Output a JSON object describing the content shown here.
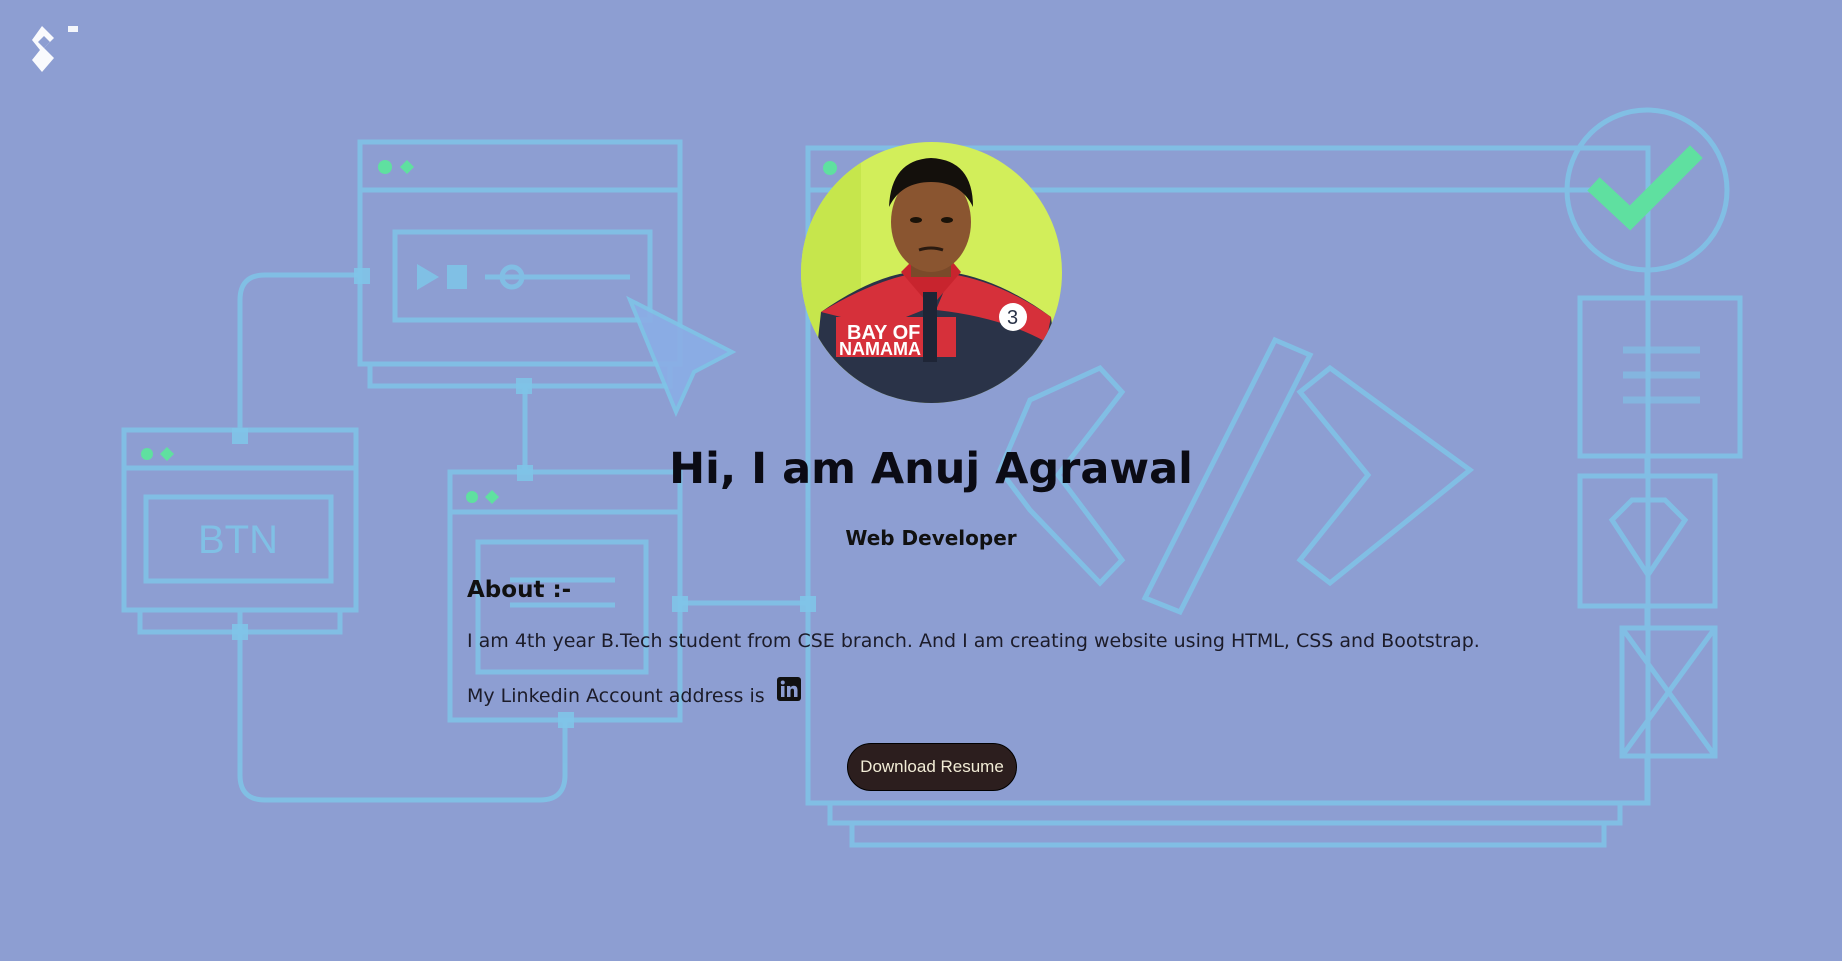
{
  "header": {
    "logo_icon": "toptal-logo-icon"
  },
  "profile": {
    "avatar_icon": "profile-photo",
    "greeting": "Hi, I am Anuj Agrawal",
    "role": "Web Developer"
  },
  "about": {
    "heading": "About :-",
    "text": "I am 4th year B.Tech student from CSE branch. And I am creating website using HTML, CSS and Bootstrap.",
    "linkedin_prefix": "My Linkedin Account address is",
    "linkedin_icon": "linkedin-icon"
  },
  "actions": {
    "download_label": "Download Resume"
  },
  "background": {
    "illustration_text": "BTN",
    "colors": {
      "page": "#8d9ed2",
      "line": "#7fc4e8",
      "accent_green": "#5fe0a0",
      "button_bg": "#2c1e1e",
      "button_text": "#f2ecd6"
    }
  }
}
